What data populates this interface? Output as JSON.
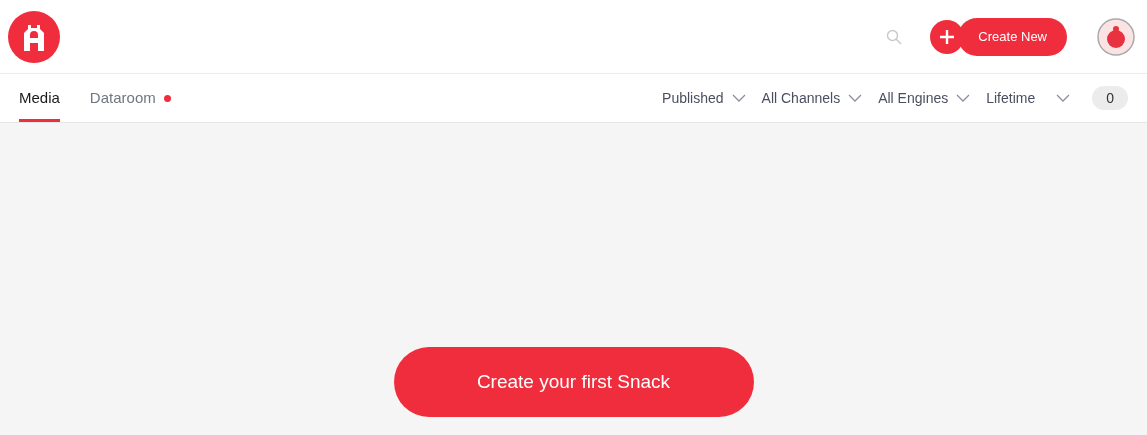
{
  "header": {
    "create_button": "Create New"
  },
  "tabs": [
    {
      "label": "Media",
      "selected": true,
      "notification": false
    },
    {
      "label": "Dataroom",
      "selected": false,
      "notification": true
    }
  ],
  "filters": [
    {
      "label": "Published"
    },
    {
      "label": "All Channels"
    },
    {
      "label": "All Engines"
    },
    {
      "label": "Lifetime"
    }
  ],
  "count": "0",
  "cta": "Create your first Snack"
}
